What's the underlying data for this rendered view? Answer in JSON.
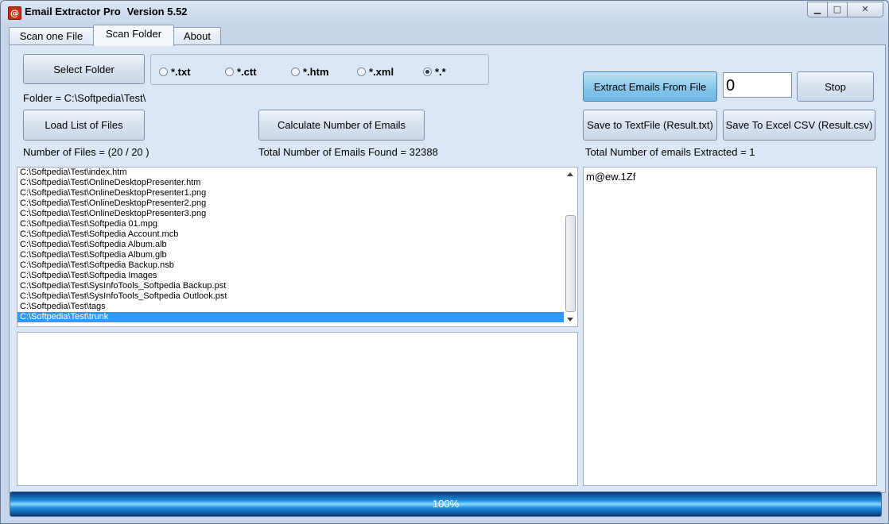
{
  "window": {
    "title": "Email Extractor Pro",
    "version": "Version 5.52",
    "icon": "at-sign-icon",
    "controls": {
      "minimize": "▁",
      "maximize": "□",
      "close": "✕"
    }
  },
  "tabs": [
    {
      "label": "Scan one File",
      "active": false
    },
    {
      "label": "Scan Folder",
      "active": true
    },
    {
      "label": "About",
      "active": false
    }
  ],
  "left": {
    "select_folder_label": "Select Folder",
    "filters": [
      {
        "label": "*.txt",
        "selected": false
      },
      {
        "label": "*.ctt",
        "selected": false
      },
      {
        "label": "*.htm",
        "selected": false
      },
      {
        "label": "*.xml",
        "selected": false
      },
      {
        "label": "*.*",
        "selected": true
      }
    ],
    "folder_text": "Folder = C:\\Softpedia\\Test\\",
    "load_list_label": "Load List of Files",
    "calculate_label": "Calculate Number of Emails",
    "num_files_text": "Number of Files = (20 / 20 )",
    "total_found_text": "Total Number of Emails Found = 32388",
    "files": [
      "C:\\Softpedia\\Test\\index.htm",
      "C:\\Softpedia\\Test\\OnlineDesktopPresenter.htm",
      "C:\\Softpedia\\Test\\OnlineDesktopPresenter1.png",
      "C:\\Softpedia\\Test\\OnlineDesktopPresenter2.png",
      "C:\\Softpedia\\Test\\OnlineDesktopPresenter3.png",
      "C:\\Softpedia\\Test\\Softpedia 01.mpg",
      "C:\\Softpedia\\Test\\Softpedia Account.mcb",
      "C:\\Softpedia\\Test\\Softpedia Album.alb",
      "C:\\Softpedia\\Test\\Softpedia Album.glb",
      "C:\\Softpedia\\Test\\Softpedia Backup.nsb",
      "C:\\Softpedia\\Test\\Softpedia Images",
      "C:\\Softpedia\\Test\\SysInfoTools_Softpedia Backup.pst",
      "C:\\Softpedia\\Test\\SysInfoTools_Softpedia Outlook.pst",
      "C:\\Softpedia\\Test\\tags",
      "C:\\Softpedia\\Test\\trunk"
    ],
    "selected_file_index": 14
  },
  "right": {
    "extract_label": "Extract Emails From File",
    "count_value": "0",
    "stop_label": "Stop",
    "save_txt_label": "Save to TextFile (Result.txt)",
    "save_csv_label": "Save To Excel CSV (Result.csv)",
    "total_extracted_text": "Total Number of emails Extracted = 1",
    "result_text": "m@ew.1Zf"
  },
  "progress": {
    "text": "100%",
    "value": 1.0
  },
  "colors": {
    "selection": "#3399ff",
    "panel": "#dbe7f5",
    "progress": "#1e8fe0"
  }
}
